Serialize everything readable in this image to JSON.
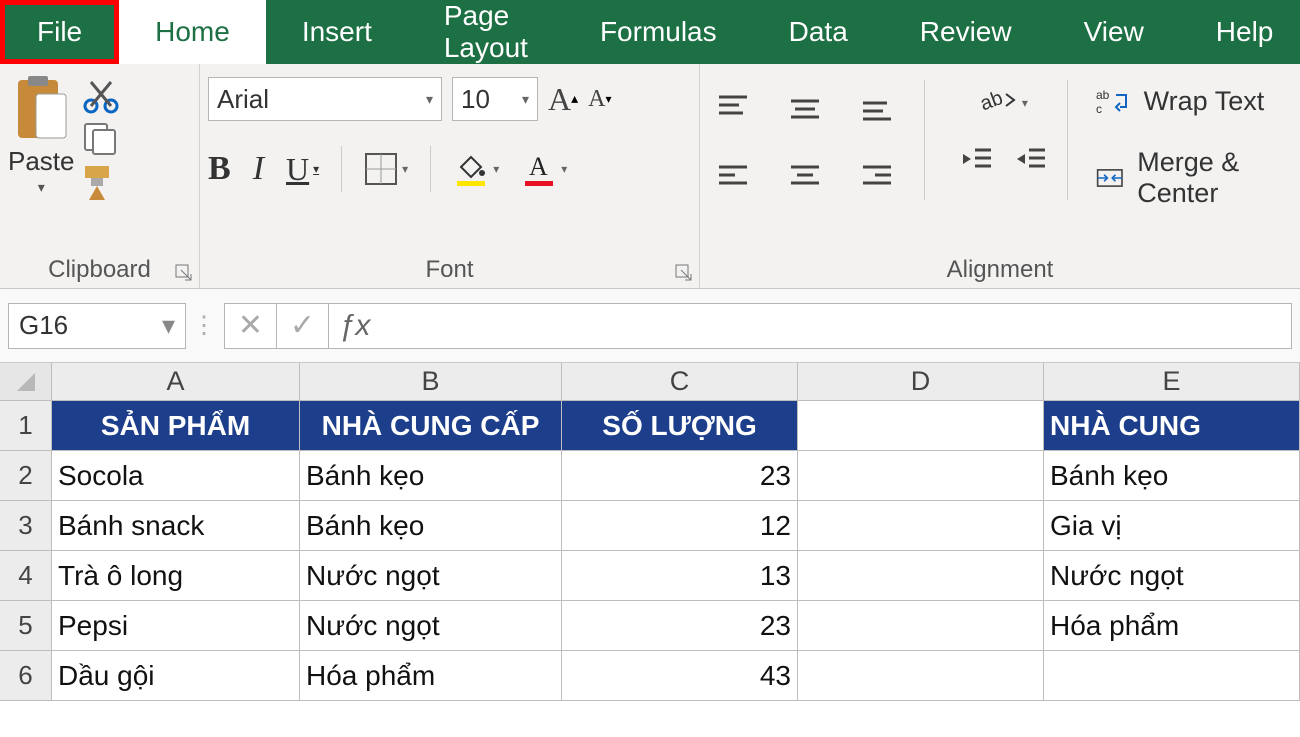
{
  "tabs": {
    "file": "File",
    "home": "Home",
    "insert": "Insert",
    "page_layout": "Page Layout",
    "formulas": "Formulas",
    "data": "Data",
    "review": "Review",
    "view": "View",
    "help": "Help"
  },
  "ribbon": {
    "clipboard": {
      "paste": "Paste",
      "label": "Clipboard"
    },
    "font": {
      "name": "Arial",
      "size": "10",
      "bold": "B",
      "italic": "I",
      "underline": "U",
      "label": "Font"
    },
    "alignment": {
      "wrap": "Wrap Text",
      "merge": "Merge & Center",
      "label": "Alignment"
    }
  },
  "formula_bar": {
    "name_box": "G16",
    "fx": "ƒx"
  },
  "columns": [
    "A",
    "B",
    "C",
    "D",
    "E"
  ],
  "rows": [
    "1",
    "2",
    "3",
    "4",
    "5",
    "6"
  ],
  "grid": {
    "headers1": {
      "A": "SẢN PHẨM",
      "B": "NHÀ CUNG CẤP",
      "C": "SỐ LƯỢNG",
      "E": "NHÀ CUNG"
    },
    "r2": {
      "A": "Socola",
      "B": "Bánh kẹo",
      "C": "23",
      "E": "Bánh kẹo"
    },
    "r3": {
      "A": "Bánh snack",
      "B": "Bánh kẹo",
      "C": "12",
      "E": "Gia vị"
    },
    "r4": {
      "A": "Trà ô long",
      "B": "Nước ngọt",
      "C": "13",
      "E": "Nước ngọt"
    },
    "r5": {
      "A": "Pepsi",
      "B": "Nước ngọt",
      "C": "23",
      "E": "Hóa phẩm"
    },
    "r6": {
      "A": "Dầu gội",
      "B": "Hóa phẩm",
      "C": "43",
      "E": ""
    }
  }
}
